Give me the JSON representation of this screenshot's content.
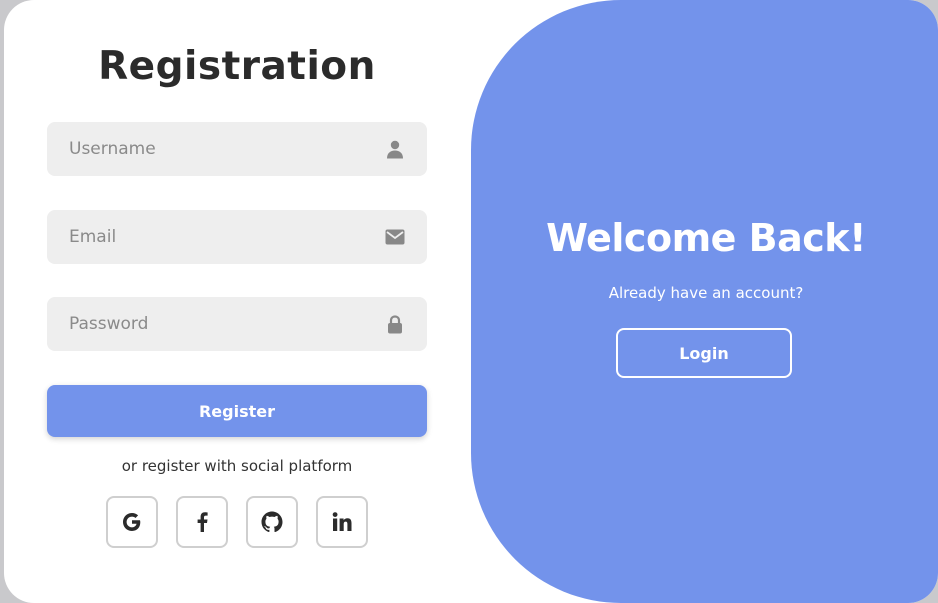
{
  "registration": {
    "title": "Registration",
    "fields": {
      "username": {
        "placeholder": "Username",
        "icon": "user-icon"
      },
      "email": {
        "placeholder": "Email",
        "icon": "envelope-icon"
      },
      "password": {
        "placeholder": "Password",
        "icon": "lock-icon"
      }
    },
    "register_label": "Register",
    "social_text": "or register with social platform",
    "social_icons": [
      "google-icon",
      "facebook-icon",
      "github-icon",
      "linkedin-icon"
    ]
  },
  "welcome": {
    "title": "Welcome Back!",
    "subtitle": "Already have an account?",
    "login_label": "Login"
  },
  "colors": {
    "accent": "#7393eb",
    "field_bg": "#eeeeee",
    "title_text": "#2b2b2b",
    "icon_gray": "#888888"
  }
}
